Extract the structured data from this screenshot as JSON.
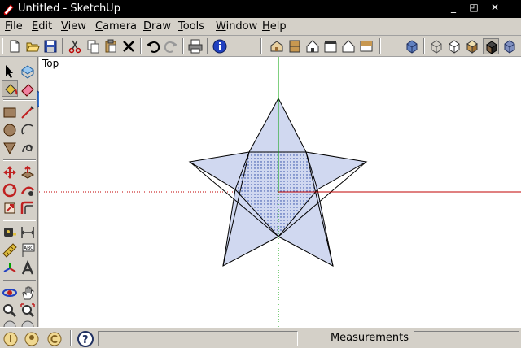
{
  "window": {
    "title": "Untitled - SketchUp",
    "minimize_glyph": "‗",
    "maximize_glyph": "◰",
    "close_glyph": "✕"
  },
  "menubar": {
    "items": [
      {
        "label": "File",
        "accel": "F"
      },
      {
        "label": "Edit",
        "accel": "E"
      },
      {
        "label": "View",
        "accel": "V"
      },
      {
        "label": "Camera",
        "accel": "C"
      },
      {
        "label": "Draw",
        "accel": "D"
      },
      {
        "label": "Tools",
        "accel": "T"
      },
      {
        "label": "Window",
        "accel": "W"
      },
      {
        "label": "Help",
        "accel": "H"
      }
    ]
  },
  "toolbar": {
    "buttons": [
      "new-file-icon",
      "open-folder-icon",
      "save-icon",
      "cut-icon",
      "copy-icon",
      "paste-icon",
      "erase-icon",
      "undo-icon",
      "redo-icon",
      "print-icon",
      "model-info-icon",
      "iso-view-icon",
      "top-view-icon",
      "front-view-icon",
      "right-view-icon",
      "back-view-icon",
      "left-view-icon",
      "xray-icon",
      "wireframe-icon",
      "hidden-line-icon",
      "shaded-icon",
      "shaded-textures-icon",
      "monochrome-icon"
    ]
  },
  "palette": {
    "tools": [
      "select-icon",
      "make-component-icon",
      "paint-bucket-icon",
      "eraser-icon",
      "rectangle-icon",
      "line-icon",
      "circle-icon",
      "arc-icon",
      "polygon-icon",
      "freehand-icon",
      "move-icon",
      "push-pull-icon",
      "rotate-icon",
      "follow-me-icon",
      "scale-icon",
      "offset-icon",
      "tape-measure-icon",
      "dimension-icon",
      "protractor-icon",
      "text-icon",
      "axes-icon",
      "3d-text-icon",
      "orbit-icon",
      "pan-icon",
      "zoom-icon",
      "zoom-extents-icon",
      "previous-view-icon",
      "next-view-icon"
    ],
    "selected_tool": "paint-bucket-icon"
  },
  "viewport": {
    "view_name": "Top",
    "colors": {
      "green_axis": "#00a000",
      "red_axis": "#c00000",
      "face_fill": "#d0d8f0",
      "edge": "#000000"
    }
  },
  "statusbar": {
    "measurements_label": "Measurements",
    "measurements_value": "",
    "help_icon": "help-icon"
  }
}
